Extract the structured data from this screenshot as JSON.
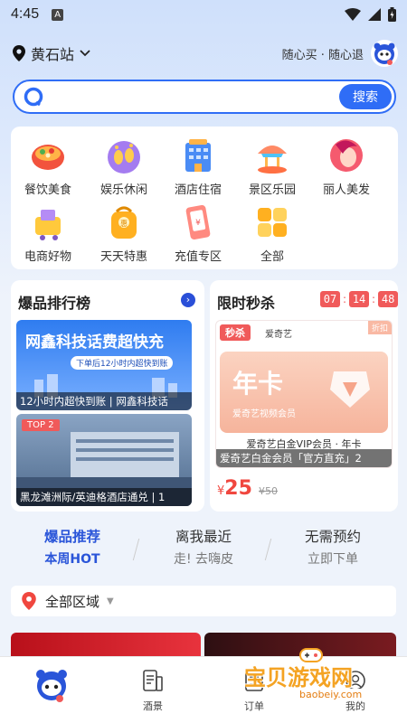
{
  "status_bar": {
    "time": "4:45",
    "notification_glyph": "A"
  },
  "header": {
    "location": "黄石站",
    "slogan": "随心买 · 随心退"
  },
  "search": {
    "placeholder": "",
    "button_label": "搜索"
  },
  "categories": [
    {
      "label": "餐饮美食",
      "icon": "food-bowl-icon"
    },
    {
      "label": "娱乐休闲",
      "icon": "footprints-icon"
    },
    {
      "label": "酒店住宿",
      "icon": "hotel-building-icon"
    },
    {
      "label": "景区乐园",
      "icon": "carousel-icon"
    },
    {
      "label": "丽人美发",
      "icon": "woman-face-icon"
    },
    {
      "label": "电商好物",
      "icon": "shopping-cart-icon"
    },
    {
      "label": "天天特惠",
      "icon": "coupon-bag-icon"
    },
    {
      "label": "充值专区",
      "icon": "phone-recharge-icon"
    },
    {
      "label": "全部",
      "icon": "grid-blocks-icon"
    }
  ],
  "hot_ranking": {
    "title": "爆品排行榜",
    "items": [
      {
        "banner_text": "网鑫科技话费超快充",
        "banner_subtext": "下单后12小时内超快到账",
        "caption": "12小时内超快到账 | 网鑫科技话"
      },
      {
        "badge": "TOP 2",
        "caption": "黑龙滩洲际/英迪格酒店通兑 | 1"
      }
    ]
  },
  "flash_sale": {
    "title": "限时秒杀",
    "timer": {
      "hours": "07",
      "minutes": "14",
      "seconds": "48"
    },
    "tag": "秒杀",
    "brand": "爱奇艺",
    "corner_tag": "折扣",
    "card_title": "年卡",
    "card_subtitle": "爱奇艺视频会员",
    "card_bottom": "爱奇艺白金VIP会员 · 年卡",
    "caption": "爱奇艺白金会员「官方直充」2",
    "price_symbol": "¥",
    "price": "25",
    "original_price": "¥50"
  },
  "tabs": [
    {
      "title": "爆品推荐",
      "subtitle": "本周HOT",
      "active": true
    },
    {
      "title": "离我最近",
      "subtitle": "走! 去嗨皮",
      "active": false
    },
    {
      "title": "无需预约",
      "subtitle": "立即下单",
      "active": false
    }
  ],
  "region": {
    "label": "全部区域"
  },
  "bottom_nav": [
    {
      "label": "",
      "icon": "mascot-home-icon"
    },
    {
      "label": "酒景",
      "icon": "document-icon"
    },
    {
      "label": "订单",
      "icon": "order-list-icon"
    },
    {
      "label": "我的",
      "icon": "profile-icon"
    }
  ],
  "watermark": {
    "main": "宝贝游戏网",
    "sub": "baobeiy.com"
  },
  "colors": {
    "accent": "#2f6df6",
    "flash_red": "#f05a5a",
    "price_red": "#f0473f"
  }
}
